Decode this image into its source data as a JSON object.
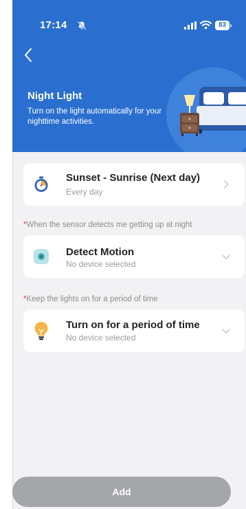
{
  "status_bar": {
    "time": "17:14",
    "battery": "83"
  },
  "header": {
    "title": "Night Light",
    "subtitle": "Turn on the light automatically for your nighttime activities."
  },
  "schedule": {
    "title": "Sunset - Sunrise  (Next day)",
    "repeat": "Every day"
  },
  "motion_section": {
    "label": "When the sensor detects me getting up at night",
    "item_title": "Detect Motion",
    "item_sub": "No device selected"
  },
  "light_section": {
    "label": "Keep the lights on for a period of time",
    "item_title": "Turn on for a period of time",
    "item_sub": "No device selected"
  },
  "add_button": "Add",
  "colors": {
    "header": "#2a6fcf",
    "button": "#a4a6aa",
    "required": "#e53935"
  }
}
